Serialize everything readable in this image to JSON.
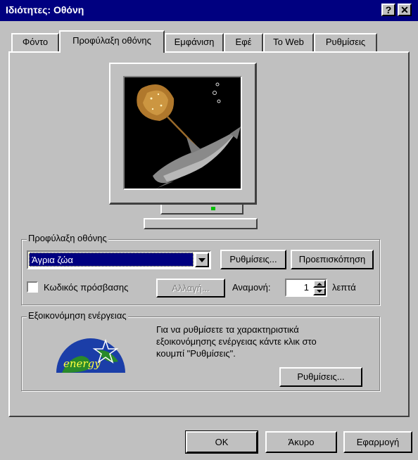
{
  "window": {
    "title": "Ιδιότητες: Οθόνη",
    "help_glyph": "?",
    "close_glyph": "✕"
  },
  "tabs": [
    {
      "label": "Φόντο"
    },
    {
      "label": "Προφύλαξη οθόνης",
      "active": true
    },
    {
      "label": "Εμφάνιση"
    },
    {
      "label": "Εφέ"
    },
    {
      "label": "To Web"
    },
    {
      "label": "Ρυθμίσεις"
    }
  ],
  "screensaver": {
    "legend": "Προφύλαξη οθόνης",
    "selected": "Άγρια ζώα",
    "settings_button": "Ρυθμίσεις...",
    "preview_button": "Προεπισκόπηση",
    "password_label": "Κωδικός πρόσβασης",
    "password_checked": false,
    "change_button": "Αλλαγή...",
    "wait_label": "Αναμονή:",
    "wait_value": "1",
    "wait_unit": "λεπτά"
  },
  "energy": {
    "legend": "Εξοικονόμηση ενέργειας",
    "description_line1": "Για να ρυθμίσετε τα χαρακτηριστικά",
    "description_line2": "εξοικονόμησης ενέργειας κάντε κλικ στο",
    "description_line3": "κουμπί \"Ρυθμίσεις\".",
    "settings_button": "Ρυθμίσεις...",
    "logo_text": "energy"
  },
  "footer": {
    "ok": "OK",
    "cancel": "Άκυρο",
    "apply": "Εφαρμογή"
  },
  "colors": {
    "titlebar": "#000080",
    "face": "#c0c0c0",
    "selection": "#000080"
  }
}
